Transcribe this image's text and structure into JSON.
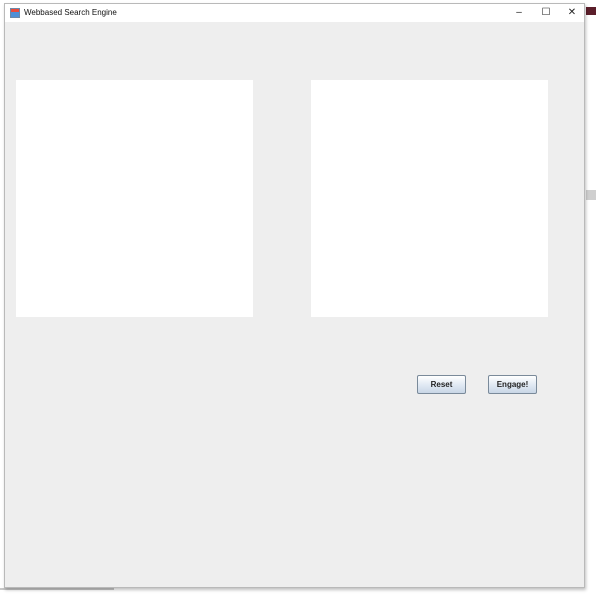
{
  "window": {
    "title": "Webbased Search Engine",
    "controls": {
      "minimize": "–",
      "maximize": "☐",
      "close": "✕"
    }
  },
  "buttons": {
    "reset_label": "Reset",
    "engage_label": "Engage!"
  },
  "icons": {
    "app": "java-app-icon"
  }
}
